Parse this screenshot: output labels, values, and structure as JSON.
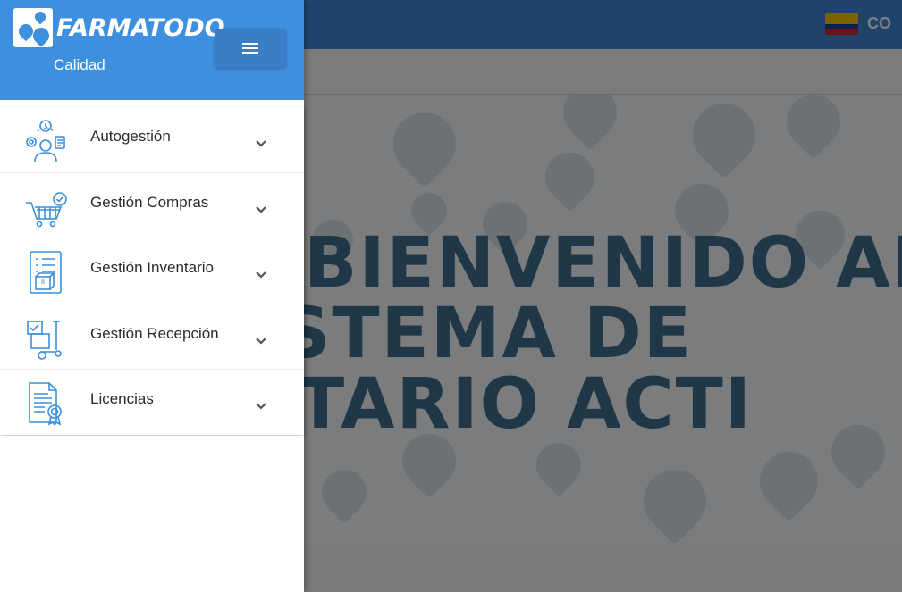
{
  "app": {
    "brand": "FARMATODO",
    "subtitle": "Calidad",
    "country_code": "CO",
    "accent_color": "#3f8fdf"
  },
  "welcome": {
    "line1": "BIENVENIDO AL",
    "line2": "SISTEMA DE",
    "line3": "VENTARIO ACTI"
  },
  "header": {
    "menu_button_icon": "hamburger-icon"
  },
  "sidebar": {
    "items": [
      {
        "label": "Autogestión",
        "icon": "self-management-icon"
      },
      {
        "label": "Gestión Compras",
        "icon": "shopping-cart-icon"
      },
      {
        "label": "Gestión Inventario",
        "icon": "inventory-clipboard-icon"
      },
      {
        "label": "Gestión Recepción",
        "icon": "hand-truck-icon"
      },
      {
        "label": "Licencias",
        "icon": "license-certificate-icon"
      }
    ]
  }
}
